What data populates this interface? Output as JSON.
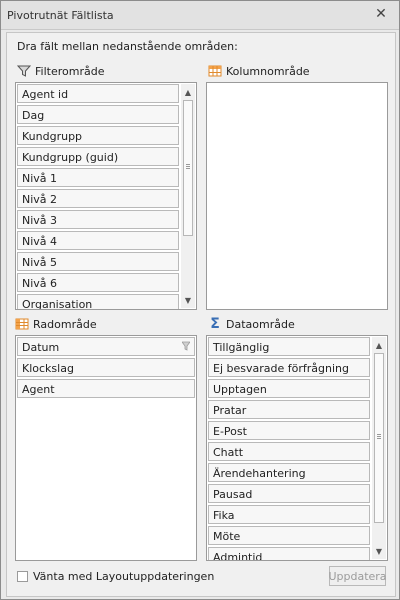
{
  "window": {
    "title": "Pivotrutnät Fältlista"
  },
  "instruction": "Dra fält mellan nedanstående områden:",
  "filter_area": {
    "label": "Filterområde",
    "icon": "funnel-icon",
    "fields": [
      "Agent id",
      "Dag",
      "Kundgrupp",
      "Kundgrupp (guid)",
      "Nivå 1",
      "Nivå 2",
      "Nivå 3",
      "Nivå 4",
      "Nivå 5",
      "Nivå 6",
      "Organisation"
    ]
  },
  "column_area": {
    "label": "Kolumnområde",
    "icon": "grid-icon",
    "fields": []
  },
  "row_area": {
    "label": "Radområde",
    "icon": "grid-icon",
    "fields": [
      "Datum",
      "Klockslag",
      "Agent"
    ]
  },
  "data_area": {
    "label": "Dataområde",
    "icon": "sigma-icon",
    "fields": [
      "Tillgänglig",
      "Ej besvarade förfrågning",
      "Upptagen",
      "Pratar",
      "E-Post",
      "Chatt",
      "Ärendehantering",
      "Pausad",
      "Fika",
      "Möte",
      "Admintid"
    ]
  },
  "defer_update": {
    "label": "Vänta med Layoutuppdateringen",
    "checked": false
  },
  "update_button": {
    "label": "Uppdatera",
    "enabled": false
  },
  "colors": {
    "background": "#f0f0f0",
    "field_border": "#b9b9b9",
    "accent_orange": "#f3a24a"
  }
}
